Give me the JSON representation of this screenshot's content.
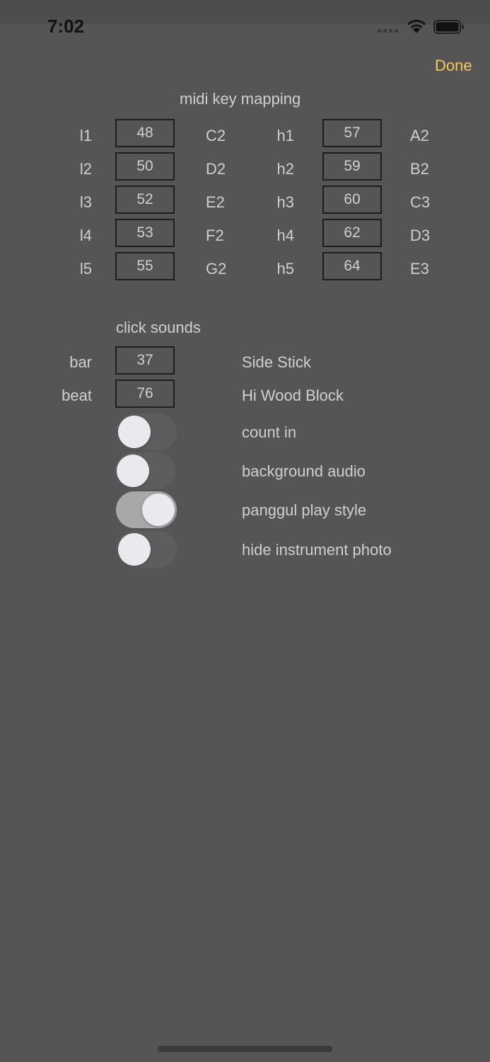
{
  "status_bar": {
    "time": "7:02"
  },
  "nav": {
    "done_label": "Done"
  },
  "midi": {
    "title": "midi key mapping",
    "rows": [
      {
        "left_label": "l1",
        "left_value": "48",
        "left_note": "C2",
        "right_label": "h1",
        "right_value": "57",
        "right_note": "A2"
      },
      {
        "left_label": "l2",
        "left_value": "50",
        "left_note": "D2",
        "right_label": "h2",
        "right_value": "59",
        "right_note": "B2"
      },
      {
        "left_label": "l3",
        "left_value": "52",
        "left_note": "E2",
        "right_label": "h3",
        "right_value": "60",
        "right_note": "C3"
      },
      {
        "left_label": "l4",
        "left_value": "53",
        "left_note": "F2",
        "right_label": "h4",
        "right_value": "62",
        "right_note": "D3"
      },
      {
        "left_label": "l5",
        "left_value": "55",
        "left_note": "G2",
        "right_label": "h5",
        "right_value": "64",
        "right_note": "E3"
      }
    ]
  },
  "click": {
    "title": "click sounds",
    "rows": [
      {
        "label": "bar",
        "value": "37",
        "name": "Side Stick"
      },
      {
        "label": "beat",
        "value": "76",
        "name": "Hi Wood Block"
      }
    ]
  },
  "toggles": [
    {
      "label": "count in",
      "on": false
    },
    {
      "label": "background audio",
      "on": false
    },
    {
      "label": "panggul play style",
      "on": true
    },
    {
      "label": "hide instrument photo",
      "on": false
    }
  ],
  "colors": {
    "background": "#555555",
    "accent": "#f5c95a",
    "text": "#cfcfcf",
    "box_border": "#1d1d1d"
  }
}
